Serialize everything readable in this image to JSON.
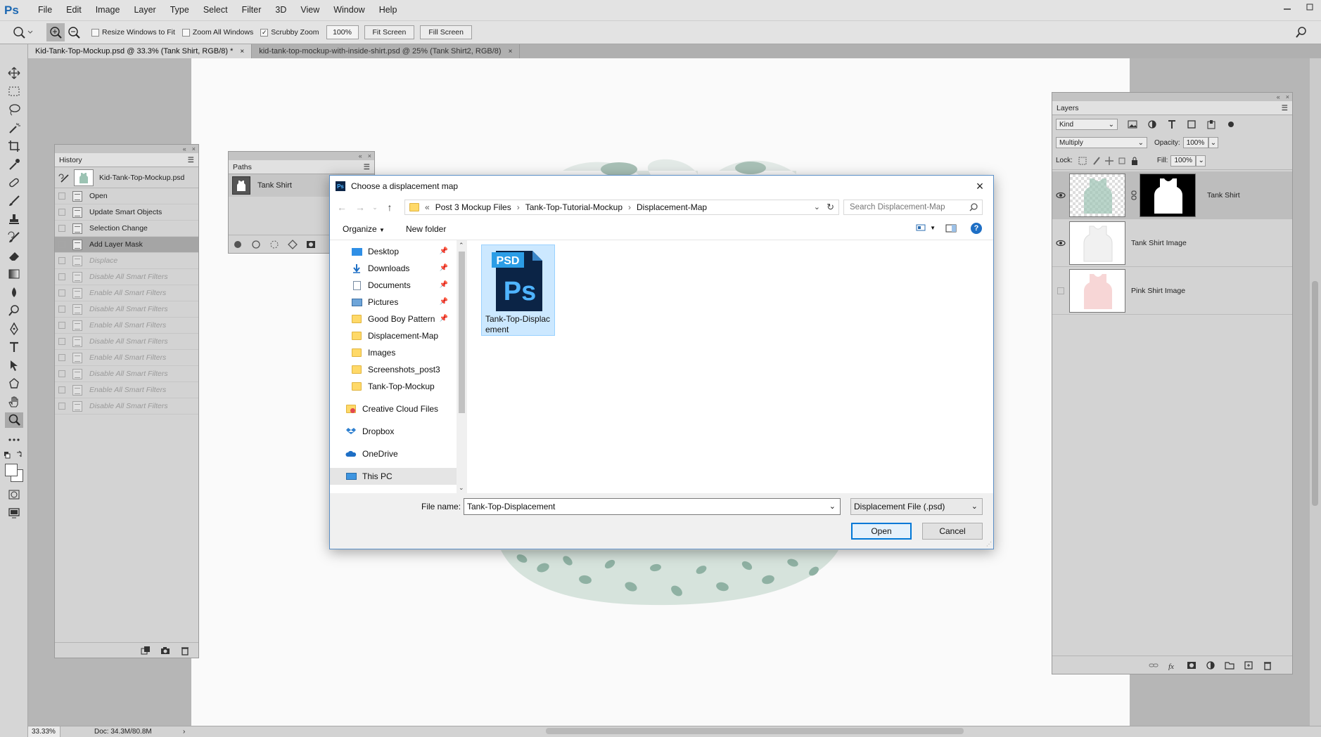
{
  "app": {
    "logo": "Ps",
    "menu": [
      "File",
      "Edit",
      "Image",
      "Layer",
      "Type",
      "Select",
      "Filter",
      "3D",
      "View",
      "Window",
      "Help"
    ],
    "accent": "#1c68b2"
  },
  "options_bar": {
    "resize_windows": "Resize Windows to Fit",
    "zoom_all": "Zoom All Windows",
    "scrubby_zoom": "Scrubby Zoom",
    "zoom_value": "100%",
    "fit_screen": "Fit Screen",
    "fill_screen": "Fill Screen"
  },
  "tabs": [
    {
      "label": "Kid-Tank-Top-Mockup.psd @ 33.3% (Tank Shirt, RGB/8) *",
      "close": "×"
    },
    {
      "label": "kid-tank-top-mockup-with-inside-shirt.psd @ 25% (Tank Shirt2, RGB/8)",
      "close": "×"
    }
  ],
  "history": {
    "title": "History",
    "snapshot": "Kid-Tank-Top-Mockup.psd",
    "items": [
      {
        "label": "Open",
        "state": "normal"
      },
      {
        "label": "Update Smart Objects",
        "state": "normal"
      },
      {
        "label": "Selection Change",
        "state": "normal"
      },
      {
        "label": "Add Layer Mask",
        "state": "selected"
      },
      {
        "label": "Displace",
        "state": "dim"
      },
      {
        "label": "Disable All Smart Filters",
        "state": "dim"
      },
      {
        "label": "Enable All Smart Filters",
        "state": "dim"
      },
      {
        "label": "Disable All Smart Filters",
        "state": "dim"
      },
      {
        "label": "Enable All Smart Filters",
        "state": "dim"
      },
      {
        "label": "Disable All Smart Filters",
        "state": "dim"
      },
      {
        "label": "Enable All Smart Filters",
        "state": "dim"
      },
      {
        "label": "Disable All Smart Filters",
        "state": "dim"
      },
      {
        "label": "Enable All Smart Filters",
        "state": "dim"
      },
      {
        "label": "Disable All Smart Filters",
        "state": "dim"
      }
    ]
  },
  "paths": {
    "title": "Paths",
    "items": [
      "Tank Shirt"
    ]
  },
  "layers": {
    "title": "Layers",
    "kind": "Kind",
    "blend_mode": "Multiply",
    "opacity_label": "Opacity:",
    "opacity": "100%",
    "lock_label": "Lock:",
    "fill_label": "Fill:",
    "fill": "100%",
    "items": [
      {
        "name": "Tank Shirt",
        "visible": true
      },
      {
        "name": "Tank Shirt Image",
        "visible": true
      },
      {
        "name": "Pink Shirt Image",
        "visible": false
      }
    ]
  },
  "status": {
    "zoom": "33.33%",
    "doc": "Doc: 34.3M/80.8M"
  },
  "dialog": {
    "title": "Choose a displacement map",
    "breadcrumb_prefix": "«",
    "breadcrumb": [
      "Post 3 Mockup Files",
      "Tank-Top-Tutorial-Mockup",
      "Displacement-Map"
    ],
    "search_placeholder": "Search Displacement-Map",
    "organize": "Organize",
    "new_folder": "New folder",
    "nav": {
      "quick": [
        {
          "label": "Desktop",
          "pinned": true
        },
        {
          "label": "Downloads",
          "pinned": true
        },
        {
          "label": "Documents",
          "pinned": true
        },
        {
          "label": "Pictures",
          "pinned": true
        },
        {
          "label": "Good Boy Pattern",
          "pinned": true
        },
        {
          "label": "Displacement-Map",
          "pinned": false
        },
        {
          "label": "Images",
          "pinned": false
        },
        {
          "label": "Screenshots_post3",
          "pinned": false
        },
        {
          "label": "Tank-Top-Mockup",
          "pinned": false
        }
      ],
      "creative_cloud": "Creative Cloud Files",
      "dropbox": "Dropbox",
      "onedrive": "OneDrive",
      "this_pc": "This PC"
    },
    "file": {
      "badge": "PSD",
      "logo": "Ps",
      "name_line1": "Tank-Top-Displac",
      "name_line2": "ement"
    },
    "filename_label": "File name:",
    "filename_value": "Tank-Top-Displacement",
    "filetype": "Displacement File (.psd)",
    "open": "Open",
    "cancel": "Cancel"
  }
}
